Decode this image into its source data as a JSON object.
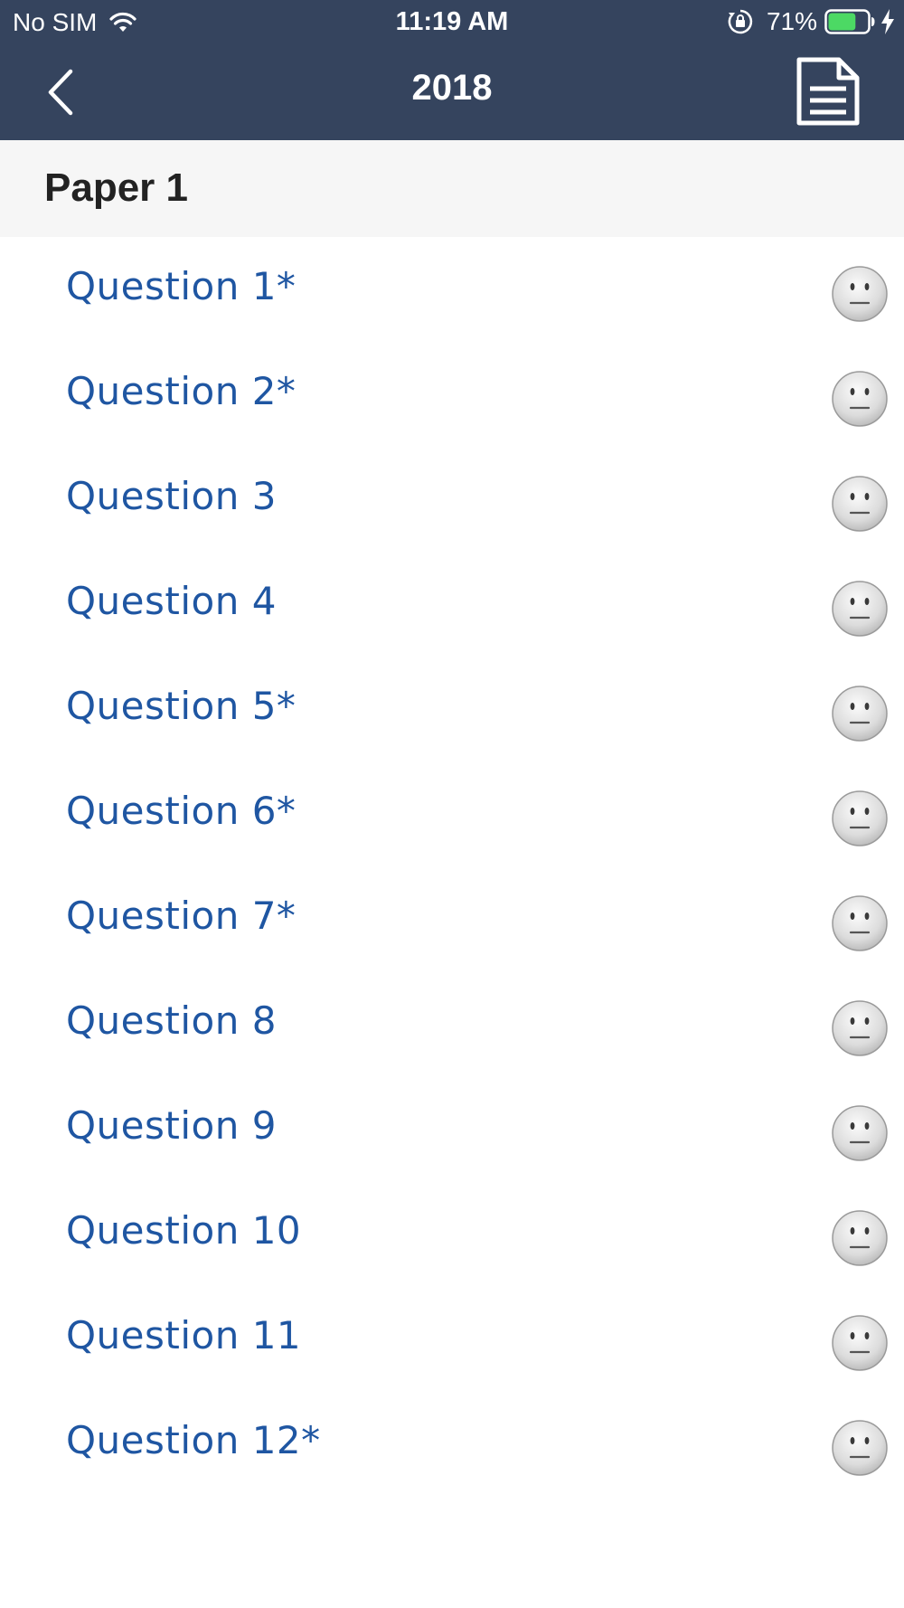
{
  "status_bar": {
    "carrier": "No SIM",
    "time": "11:19 AM",
    "battery_percent": "71%",
    "battery_level": 0.71,
    "wifi_icon": "wifi-icon",
    "orientation_lock_icon": "orientation-lock-icon",
    "charging_icon": "bolt-icon"
  },
  "nav": {
    "title": "2018",
    "back_icon": "chevron-left-icon",
    "document_icon": "document-icon"
  },
  "section": {
    "title": "Paper 1"
  },
  "questions": [
    {
      "label": "Question 1*",
      "status_icon": "neutral-face-icon"
    },
    {
      "label": "Question 2*",
      "status_icon": "neutral-face-icon"
    },
    {
      "label": "Question 3",
      "status_icon": "neutral-face-icon"
    },
    {
      "label": "Question 4",
      "status_icon": "neutral-face-icon"
    },
    {
      "label": "Question 5*",
      "status_icon": "neutral-face-icon"
    },
    {
      "label": "Question 6*",
      "status_icon": "neutral-face-icon"
    },
    {
      "label": "Question 7*",
      "status_icon": "neutral-face-icon"
    },
    {
      "label": "Question 8",
      "status_icon": "neutral-face-icon"
    },
    {
      "label": "Question 9",
      "status_icon": "neutral-face-icon"
    },
    {
      "label": "Question 10",
      "status_icon": "neutral-face-icon"
    },
    {
      "label": "Question 11",
      "status_icon": "neutral-face-icon"
    },
    {
      "label": "Question 12*",
      "status_icon": "neutral-face-icon"
    }
  ],
  "colors": {
    "header_bg": "#35445e",
    "section_bg": "#f6f6f6",
    "link_blue": "#1f56a2",
    "battery_green": "#4cd964"
  }
}
